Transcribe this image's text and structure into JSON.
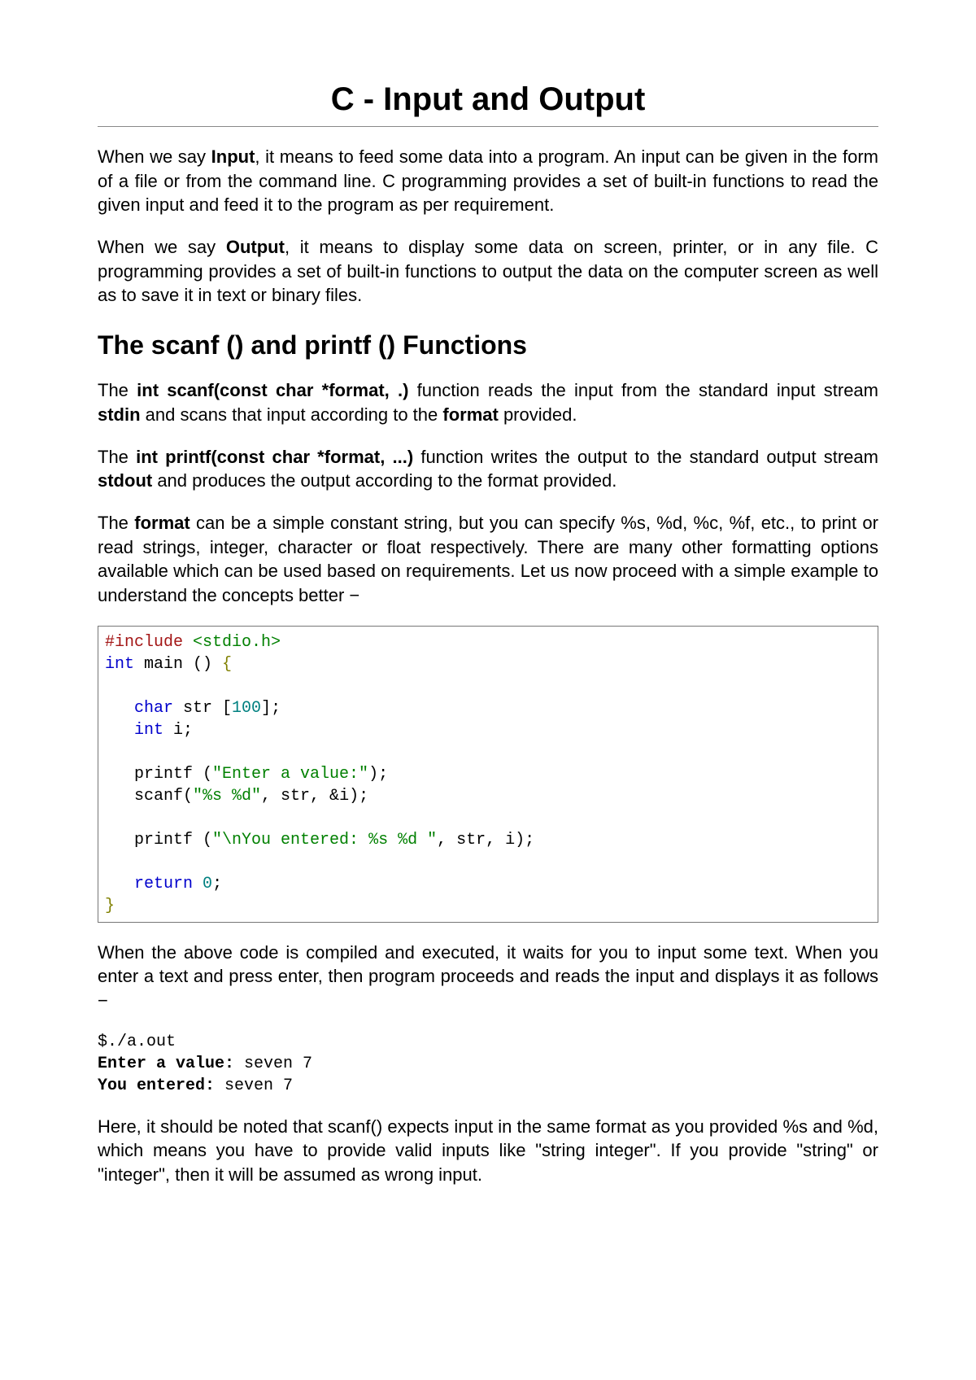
{
  "title": "C - Input and Output",
  "p1": {
    "a": "When we say ",
    "b": "Input",
    "c": ", it means to feed some data into a program. An input can be given in the form of a file or from the command line. C programming provides a set of built-in functions to read the given input and feed it to the program as per requirement."
  },
  "p2": {
    "a": "When we say ",
    "b": "Output",
    "c": ", it means to display some data on screen, printer, or in any file. C programming provides a set of built-in functions to output the data on the computer screen as well as to save it in text or binary files."
  },
  "h2": "The scanf () and printf () Functions",
  "p3": {
    "a": "The ",
    "b": "int scanf(const char *format, .)",
    "c": " function reads the input from the standard input stream ",
    "d": "stdin",
    "e": " and scans that input according to the ",
    "f": "format",
    "g": " provided."
  },
  "p4": {
    "a": "The ",
    "b": "int printf(const char *format, ...)",
    "c": " function writes the output to the standard output stream ",
    "d": "stdout",
    "e": " and produces the output according to the format provided."
  },
  "p5": {
    "a": "The ",
    "b": "format",
    "c": " can be a simple constant string, but you can specify %s, %d, %c, %f, etc., to print or read strings, integer, character or float respectively. There are many other formatting options available which can be used based on requirements. Let us now proceed with a simple example to understand the concepts better −"
  },
  "code": {
    "include1": "#include",
    "include2": "<stdio.h>",
    "int": "int",
    "main_sig": " main () ",
    "lbrace": "{",
    "char": "char",
    "str_decl": " str [",
    "num100": "100",
    "str_decl_end": "];",
    "int2": "int",
    "i_decl": " i;",
    "printf1_call": "printf (",
    "str1": "\"Enter a value:\"",
    "printf1_end": ");",
    "scanf_call": "scanf(",
    "str2": "\"%s %d\"",
    "scanf_args": ", str, &i);",
    "printf2_call": "printf (",
    "str3": "\"\\nYou entered: %s %d \"",
    "printf2_args": ", str, i);",
    "return": "return",
    "zero": "0",
    "semi": ";",
    "rbrace": "}"
  },
  "p6": "When the above code is compiled and executed, it waits for you to input some text. When you enter a text and press enter, then program proceeds and reads the input and displays it as follows −",
  "terminal": {
    "l1": "$./a.out",
    "l2a": "Enter a value:",
    "l2b": " seven 7",
    "l3a": "You entered:",
    "l3b": " seven 7"
  },
  "p7": "Here, it should be noted that scanf() expects input in the same format as you provided %s and %d, which means you have to provide valid inputs like \"string integer\". If you provide \"string\" or \"integer\", then it will be assumed as wrong input."
}
